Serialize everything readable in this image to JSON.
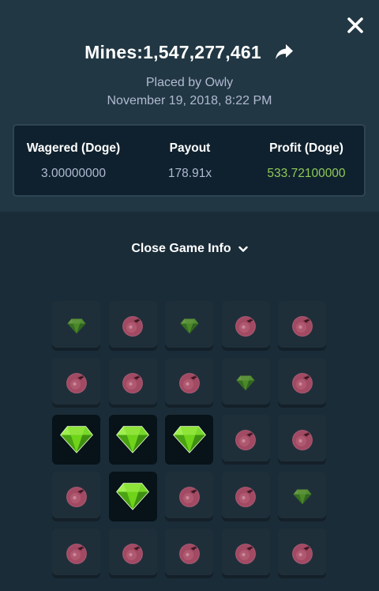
{
  "header": {
    "title": "Mines:1,547,277,461",
    "placed_by": "Placed by Owly",
    "date": "November 19, 2018, 8:22 PM"
  },
  "stats": [
    {
      "label": "Wagered (Doge)",
      "value": "3.00000000"
    },
    {
      "label": "Payout",
      "value": "178.91x"
    },
    {
      "label": "Profit (Doge)",
      "value": "533.72100000"
    }
  ],
  "toggle": {
    "label": "Close Game Info",
    "icon": "chevron-down-icon"
  },
  "colors": {
    "gem": "#6fd41a",
    "mine": "#a24a63",
    "profit": "#8fc95a",
    "panel": "#213743",
    "background": "#1a2c38"
  },
  "grid": {
    "rows": 5,
    "cols": 5,
    "tiles": [
      "gem-dim",
      "mine",
      "gem-dim",
      "mine",
      "mine",
      "mine",
      "mine",
      "mine",
      "gem-dim",
      "mine",
      "gem",
      "gem",
      "gem",
      "mine",
      "mine",
      "mine",
      "gem",
      "mine",
      "mine",
      "gem-dim",
      "mine",
      "mine",
      "mine",
      "mine",
      "mine"
    ]
  }
}
